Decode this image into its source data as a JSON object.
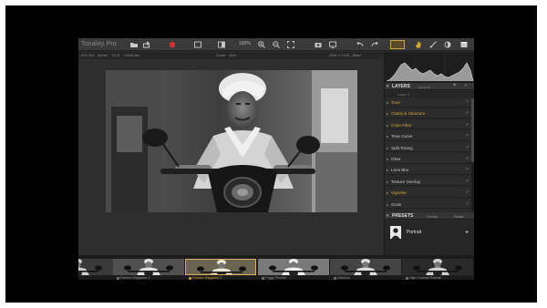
{
  "app": {
    "title": "Tonality Pro"
  },
  "toolbar": {
    "zoom_label": "100%",
    "icons": [
      "folder-icon",
      "export-icon",
      "record-icon",
      "crop-icon",
      "compare-icon",
      "zoom-in-icon",
      "zoom-out-icon",
      "fit-icon",
      "camera-icon",
      "undo-icon",
      "redo-icon",
      "hand-icon",
      "brush-icon",
      "mask-icon",
      "panel-icon"
    ],
    "accent": "#c8a040",
    "record_color": "#d03030"
  },
  "info_bar": {
    "left_items": [
      "ISO 200",
      "50mm",
      "f/2.8",
      "1/160 sec"
    ],
    "center_label": "Zoom:",
    "center_value": "44%",
    "right_value": "2560 x 1440 - 8Mpx"
  },
  "panel": {
    "layers": {
      "title": "LAYERS",
      "opacity_label": "Opacity:",
      "row_label": "Layer 1"
    },
    "filters": [
      {
        "label": "Tone",
        "highlight": true
      },
      {
        "label": "Clarity & Structure",
        "highlight": true
      },
      {
        "label": "Color Filter",
        "highlight": true
      },
      {
        "label": "Tone Curve",
        "highlight": false
      },
      {
        "label": "Split Toning",
        "highlight": false
      },
      {
        "label": "Glow",
        "highlight": false
      },
      {
        "label": "Lens Blur",
        "highlight": false
      },
      {
        "label": "Texture Overlay",
        "highlight": false
      },
      {
        "label": "Vignette",
        "highlight": true
      },
      {
        "label": "Grain",
        "highlight": false
      }
    ],
    "presets": {
      "title": "PRESETS",
      "create_label": "Create",
      "reset_label": "Reset",
      "current": "Portrait"
    }
  },
  "filmstrip": {
    "items": [
      {
        "caption": "",
        "active": false
      },
      {
        "caption": "Fashion Magazine 1",
        "active": false
      },
      {
        "caption": "Fashion Magazine 2",
        "active": true
      },
      {
        "caption": "Foggy Portrait",
        "active": false
      },
      {
        "caption": "Glamour",
        "active": false
      },
      {
        "caption": "High Contrast Portrait",
        "active": false
      }
    ]
  }
}
